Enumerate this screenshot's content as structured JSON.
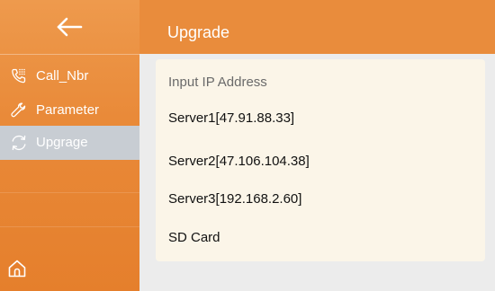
{
  "sidebar": {
    "items": [
      {
        "label": "Call_Nbr",
        "icon": "phone-icon",
        "active": false
      },
      {
        "label": "Parameter",
        "icon": "wrench-icon",
        "active": false
      },
      {
        "label": "Upgrage",
        "icon": "refresh-icon",
        "active": true
      }
    ],
    "back_icon": "back-arrow-icon",
    "home_icon": "home-icon"
  },
  "header": {
    "title": "Upgrade"
  },
  "main": {
    "heading": "Input IP Address",
    "options": [
      "Server1[47.91.88.33]",
      "Server2[47.106.104.38]",
      "Server3[192.168.2.60]",
      "SD Card"
    ]
  },
  "colors": {
    "accent": "#e98c3c",
    "active_item": "#c8cdd3",
    "card_background": "#fbf5e8",
    "page_background": "#ececec"
  }
}
